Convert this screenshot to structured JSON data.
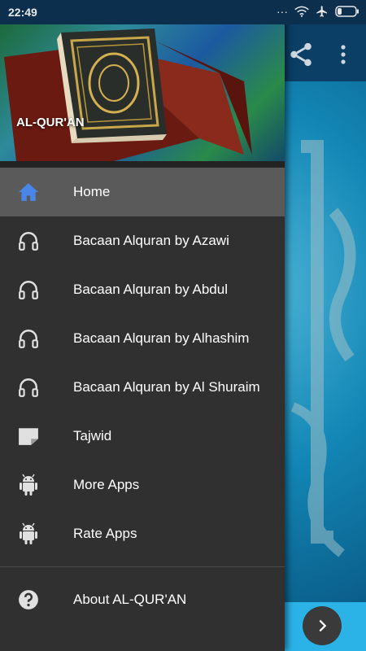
{
  "status_bar": {
    "time": "22:49",
    "dots": "···"
  },
  "app": {
    "share_icon": "share-icon",
    "more_icon": "more-vertical-icon"
  },
  "drawer": {
    "header_title": "AL-QUR'AN",
    "items": [
      {
        "label": "Home",
        "icon": "home-icon",
        "selected": true
      },
      {
        "label": "Bacaan Alquran by Azawi",
        "icon": "headphones-icon"
      },
      {
        "label": "Bacaan Alquran by Abdul",
        "icon": "headphones-icon"
      },
      {
        "label": "Bacaan Alquran by Alhashim",
        "icon": "headphones-icon"
      },
      {
        "label": "Bacaan Alquran by Al Shuraim",
        "icon": "headphones-icon"
      },
      {
        "label": "Tajwid",
        "icon": "note-icon"
      },
      {
        "label": "More Apps",
        "icon": "android-icon"
      },
      {
        "label": "Rate Apps",
        "icon": "android-icon"
      }
    ],
    "footer_items": [
      {
        "label": "About AL-QUR'AN",
        "icon": "help-icon"
      }
    ]
  },
  "colors": {
    "drawer_bg": "#303030",
    "selected_bg": "#5a5a5a",
    "home_icon": "#4a86e8",
    "status_bar": "#0c2f4e"
  }
}
